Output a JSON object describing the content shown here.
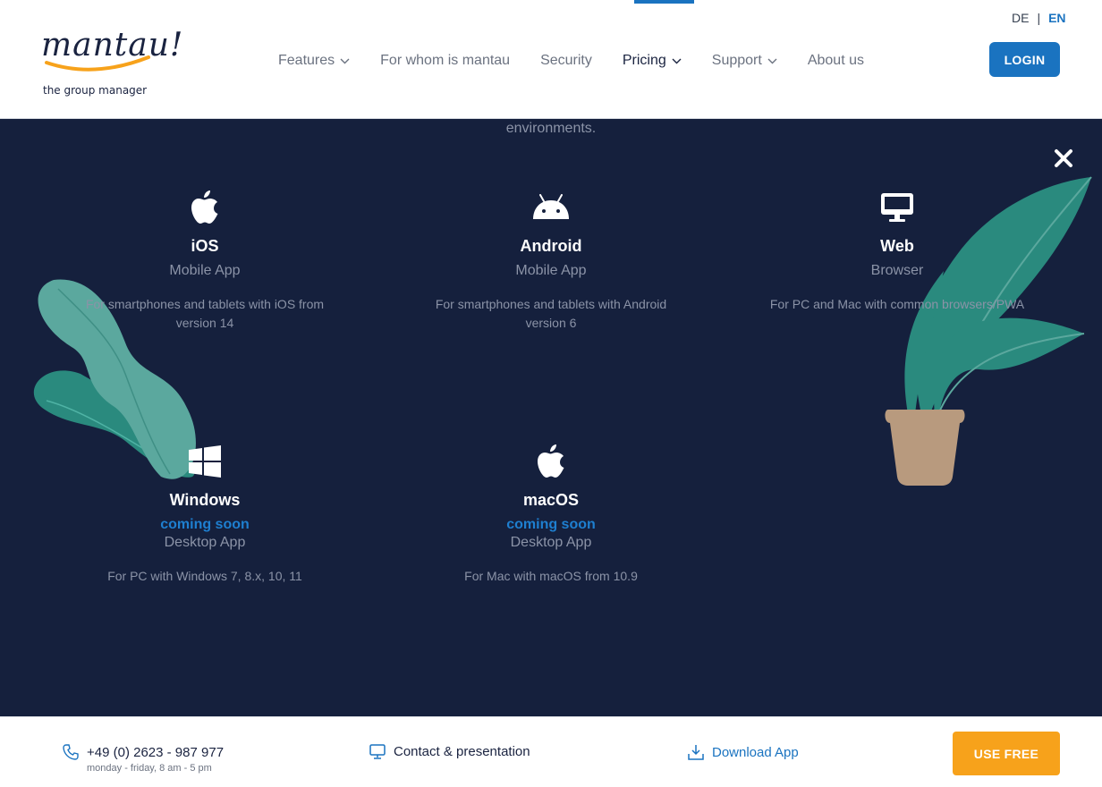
{
  "header": {
    "logo_word": "mantau!",
    "logo_tagline": "the group manager",
    "nav": [
      {
        "label": "Features",
        "has_dropdown": true
      },
      {
        "label": "For whom is mantau",
        "has_dropdown": false
      },
      {
        "label": "Security",
        "has_dropdown": false
      },
      {
        "label": "Pricing",
        "has_dropdown": true,
        "active": true
      },
      {
        "label": "Support",
        "has_dropdown": true
      },
      {
        "label": "About us",
        "has_dropdown": false
      }
    ],
    "lang": {
      "de": "DE",
      "separator": "|",
      "en": "EN",
      "active": "EN"
    },
    "login_label": "LOGIN"
  },
  "section": {
    "lead_text": "environments.",
    "platforms": [
      {
        "name": "iOS",
        "type": "Mobile App",
        "description": "For smartphones and tablets with iOS from version 14",
        "icon": "apple-icon"
      },
      {
        "name": "Android",
        "type": "Mobile App",
        "description": "For smartphones and tablets with Android version 6",
        "icon": "android-icon"
      },
      {
        "name": "Web",
        "type": "Browser",
        "description": "For PC and Mac with common browsers/PWA",
        "icon": "monitor-icon"
      },
      {
        "name": "Windows",
        "badge": "coming soon",
        "type": "Desktop App",
        "description": "For PC with Windows 7, 8.x, 10, 11",
        "icon": "windows-icon"
      },
      {
        "name": "macOS",
        "badge": "coming soon",
        "type": "Desktop App",
        "description": "For Mac with macOS from 10.9",
        "icon": "apple-icon"
      }
    ]
  },
  "footer": {
    "phone": "+49 (0) 2623 - 987 977",
    "phone_hours": "monday - friday, 8 am - 5 pm",
    "contact_label": "Contact & presentation",
    "download_label": "Download App",
    "cta_label": "USE FREE"
  },
  "colors": {
    "brand_blue": "#1a73c0",
    "dark_bg": "#15203d",
    "cta_orange": "#f7a21b",
    "logo_swoosh": "#f7a21b",
    "leaf_teal": "#2a8a7e",
    "pot": "#b89a7e"
  }
}
